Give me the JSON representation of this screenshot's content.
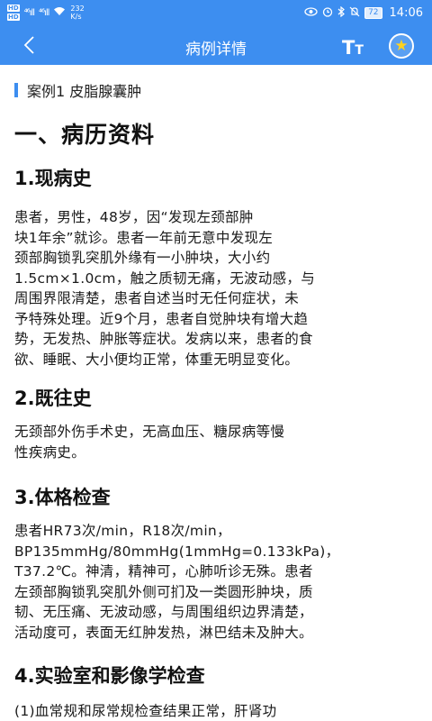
{
  "status_bar": {
    "hd1": "HD",
    "hd2": "HD",
    "signal1": "⁴⁶ıll",
    "signal2": "⁴⁶ıll",
    "wifi": "📶",
    "speed_value": "232",
    "speed_unit": "K/s",
    "battery": "72",
    "time": "14:06"
  },
  "app_bar": {
    "title": "病例详情",
    "font_big": "T",
    "font_small": "T",
    "fav_star": "★"
  },
  "content": {
    "case_title": "案例1 皮脂腺囊肿",
    "section_title": "一、病历资料",
    "h_present": "1.现病史",
    "p_present": "        患者，男性，48岁，因“发现左颈部肿\n块1年余”就诊。患者一年前无意中发现左\n颈部胸锁乳突肌外缘有一小肿块，大小约\n1.5cm×1.0cm，触之质韧无痛，无波动感，与\n周围界限清楚，患者自述当时无任何症状，未\n予特殊处理。近9个月，患者自觉肿块有增大趋\n势，无发热、肿胀等症状。发病以来，患者的食\n欲、睡眠、大小便均正常，体重无明显变化。",
    "h_past": "2.既往史",
    "p_past": "        无颈部外伤手术史，无高血压、糖尿病等慢\n性疾病史。",
    "h_exam": "3.体格检查",
    "p_exam": "        患者HR73次/min，R18次/min，\nBP135mmHg/80mmHg(1mmHg=0.133kPa)，\nT37.2℃。神清，精神可，心肺听诊无殊。患者\n左颈部胸锁乳突肌外侧可扪及一类圆形肿块，质\n韧、无压痛、无波动感，与周围组织边界清楚，\n活动度可，表面无红肿发热，淋巴结未及肿大。",
    "h_lab": "4.实验室和影像学检查",
    "p_lab": "        (1)血常规和尿常规检查结果正常，肝肾功"
  }
}
